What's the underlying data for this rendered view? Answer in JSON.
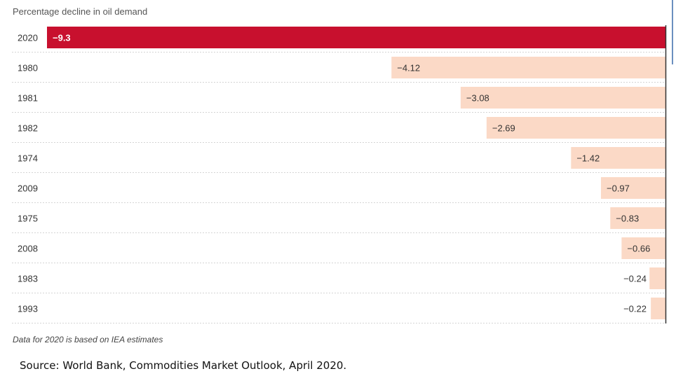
{
  "chart_data": {
    "type": "bar",
    "orientation": "horizontal",
    "title": "Percentage decline in oil demand",
    "categories": [
      "2020",
      "1980",
      "1981",
      "1982",
      "1974",
      "2009",
      "1975",
      "2008",
      "1983",
      "1993"
    ],
    "values": [
      -9.3,
      -4.12,
      -3.08,
      -2.69,
      -1.42,
      -0.97,
      -0.83,
      -0.66,
      -0.24,
      -0.22
    ],
    "value_labels": [
      "−9.3",
      "−4.12",
      "−3.08",
      "−2.69",
      "−1.42",
      "−0.97",
      "−0.83",
      "−0.66",
      "−0.24",
      "−0.22"
    ],
    "highlight_category": "2020",
    "xlim": [
      -9.3,
      0
    ],
    "colors": {
      "highlight": "#c8102e",
      "default": "#fbd9c6",
      "highlight_label": "#ffffff",
      "default_label": "#333333"
    },
    "note": "Data for 2020 is based on IEA estimates",
    "source": "Source: World Bank, Commodities Market Outlook, April 2020."
  }
}
